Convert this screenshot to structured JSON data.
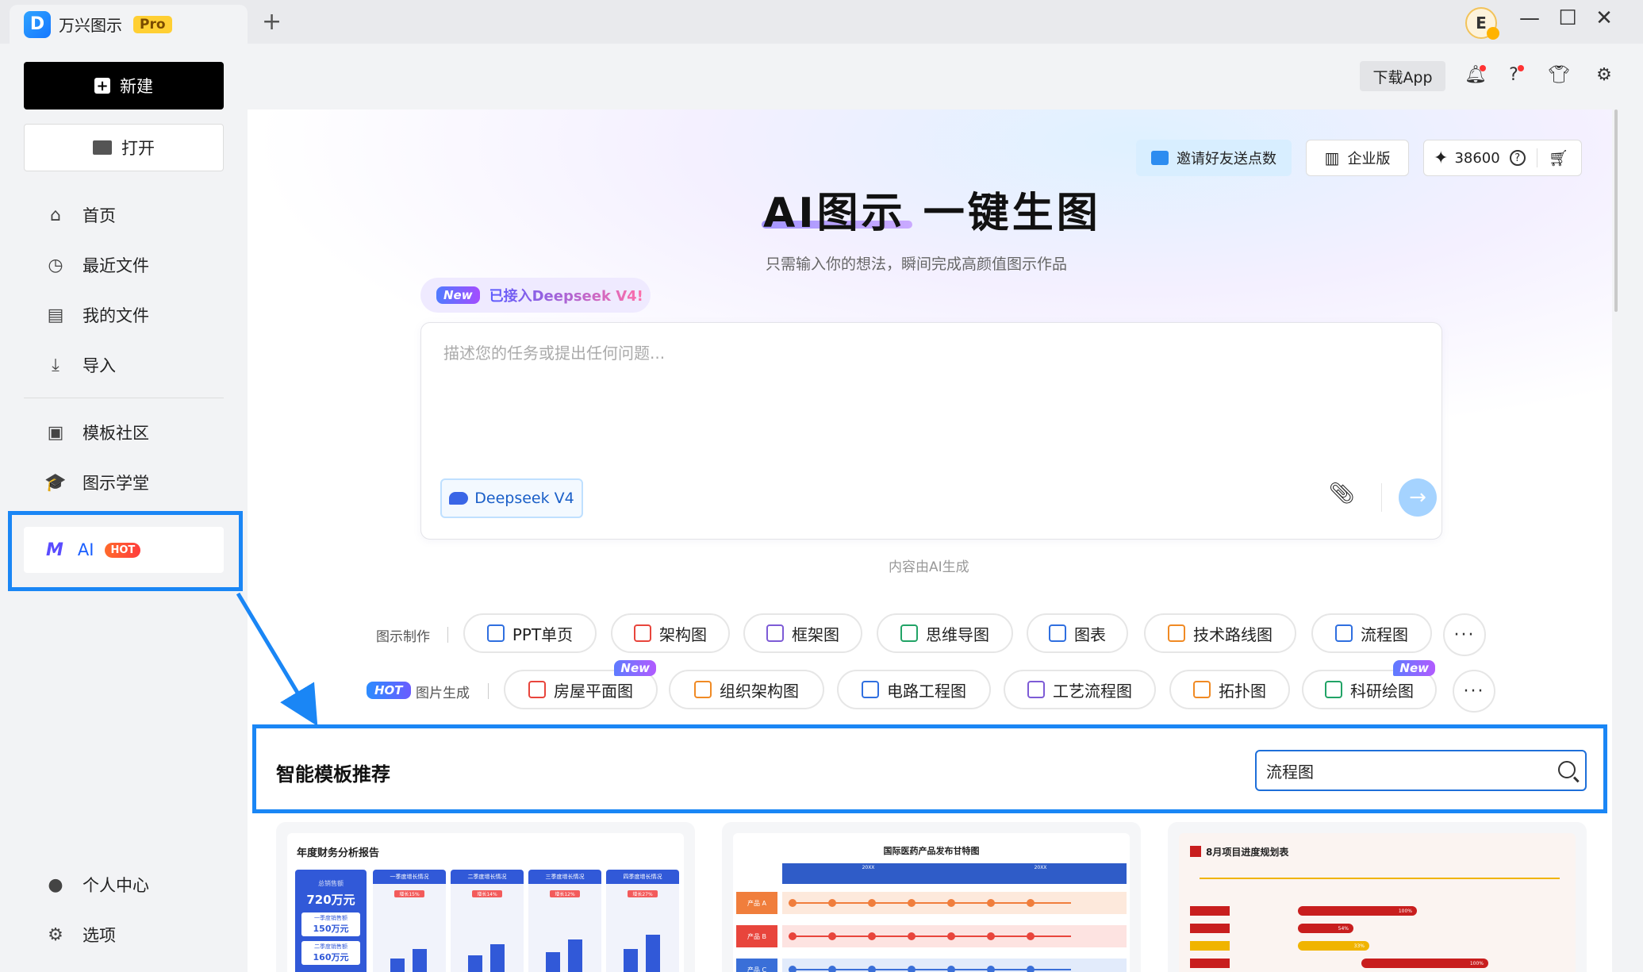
{
  "titlebar": {
    "app_name": "万兴图示",
    "edition_badge": "Pro",
    "new_tab": "+",
    "avatar_letter": "E",
    "minimize": "—",
    "maximize": "☐",
    "close": "✕"
  },
  "sidebar": {
    "new_label": "新建",
    "open_label": "打开",
    "items": [
      {
        "label": "首页",
        "icon": "home-icon"
      },
      {
        "label": "最近文件",
        "icon": "clock-icon"
      },
      {
        "label": "我的文件",
        "icon": "file-icon"
      },
      {
        "label": "导入",
        "icon": "import-icon"
      },
      {
        "label": "模板社区",
        "icon": "community-icon"
      },
      {
        "label": "图示学堂",
        "icon": "graduation-icon"
      }
    ],
    "ai_label": "AI",
    "ai_badge": "HOT",
    "bottom": [
      {
        "label": "个人中心",
        "icon": "user-icon"
      },
      {
        "label": "选项",
        "icon": "gear-icon"
      }
    ]
  },
  "header": {
    "download_app": "下载App"
  },
  "hero": {
    "invite": "邀请好友送点数",
    "enterprise": "企业版",
    "credits": "38600",
    "title": "AI图示 一键生图",
    "subtitle": "只需输入你的想法，瞬间完成高颜值图示作品",
    "new_tag": "New",
    "deepseek_text": "已接入Deepseek V4!",
    "prompt_placeholder": "描述您的任务或提出任何问题...",
    "model": "Deepseek V4",
    "ai_note": "内容由AI生成"
  },
  "rows": {
    "diagram_label": "图示制作",
    "diagram_chips": [
      {
        "label": "PPT单页",
        "color": "#2f6fe0"
      },
      {
        "label": "架构图",
        "color": "#e8453c"
      },
      {
        "label": "框架图",
        "color": "#7d5bd6"
      },
      {
        "label": "思维导图",
        "color": "#21a366"
      },
      {
        "label": "图表",
        "color": "#2f6fe0"
      },
      {
        "label": "技术路线图",
        "color": "#f08a24"
      },
      {
        "label": "流程图",
        "color": "#2f6fe0"
      }
    ],
    "image_hot": "HOT",
    "image_label": "图片生成",
    "image_chips": [
      {
        "label": "房屋平面图",
        "color": "#e8453c",
        "badge": "New"
      },
      {
        "label": "组织架构图",
        "color": "#f08a24",
        "badge": ""
      },
      {
        "label": "电路工程图",
        "color": "#2f6fe0",
        "badge": ""
      },
      {
        "label": "工艺流程图",
        "color": "#7d5bd6",
        "badge": ""
      },
      {
        "label": "拓扑图",
        "color": "#f08a24",
        "badge": ""
      },
      {
        "label": "科研绘图",
        "color": "#21a366",
        "badge": "New"
      }
    ],
    "more": "···"
  },
  "recommend": {
    "title": "智能模板推荐",
    "search_value": "流程图",
    "cards": [
      {
        "title": "年度财务分析报告",
        "summary_label": "总销售额",
        "summary_value": "720万元",
        "sub1_label": "一季度销售额",
        "sub1_value": "150万元",
        "sub2_label": "二季度销售额",
        "sub2_value": "160万元",
        "columns": [
          {
            "name": "一季度增长情况",
            "badge": "增长15%"
          },
          {
            "name": "二季度增长情况",
            "badge": "增长14%"
          },
          {
            "name": "三季度增长情况",
            "badge": "增长12%"
          },
          {
            "name": "四季度增长情况",
            "badge": "增长27%"
          }
        ]
      },
      {
        "title": "国际医药产品发布甘特图",
        "year": "20XX",
        "rows": [
          "产品 A",
          "产品 B",
          "产品 C"
        ]
      },
      {
        "title": "8月项目进度规划表",
        "bars": [
          "100%",
          "54%",
          "33%",
          "100%"
        ]
      }
    ]
  }
}
